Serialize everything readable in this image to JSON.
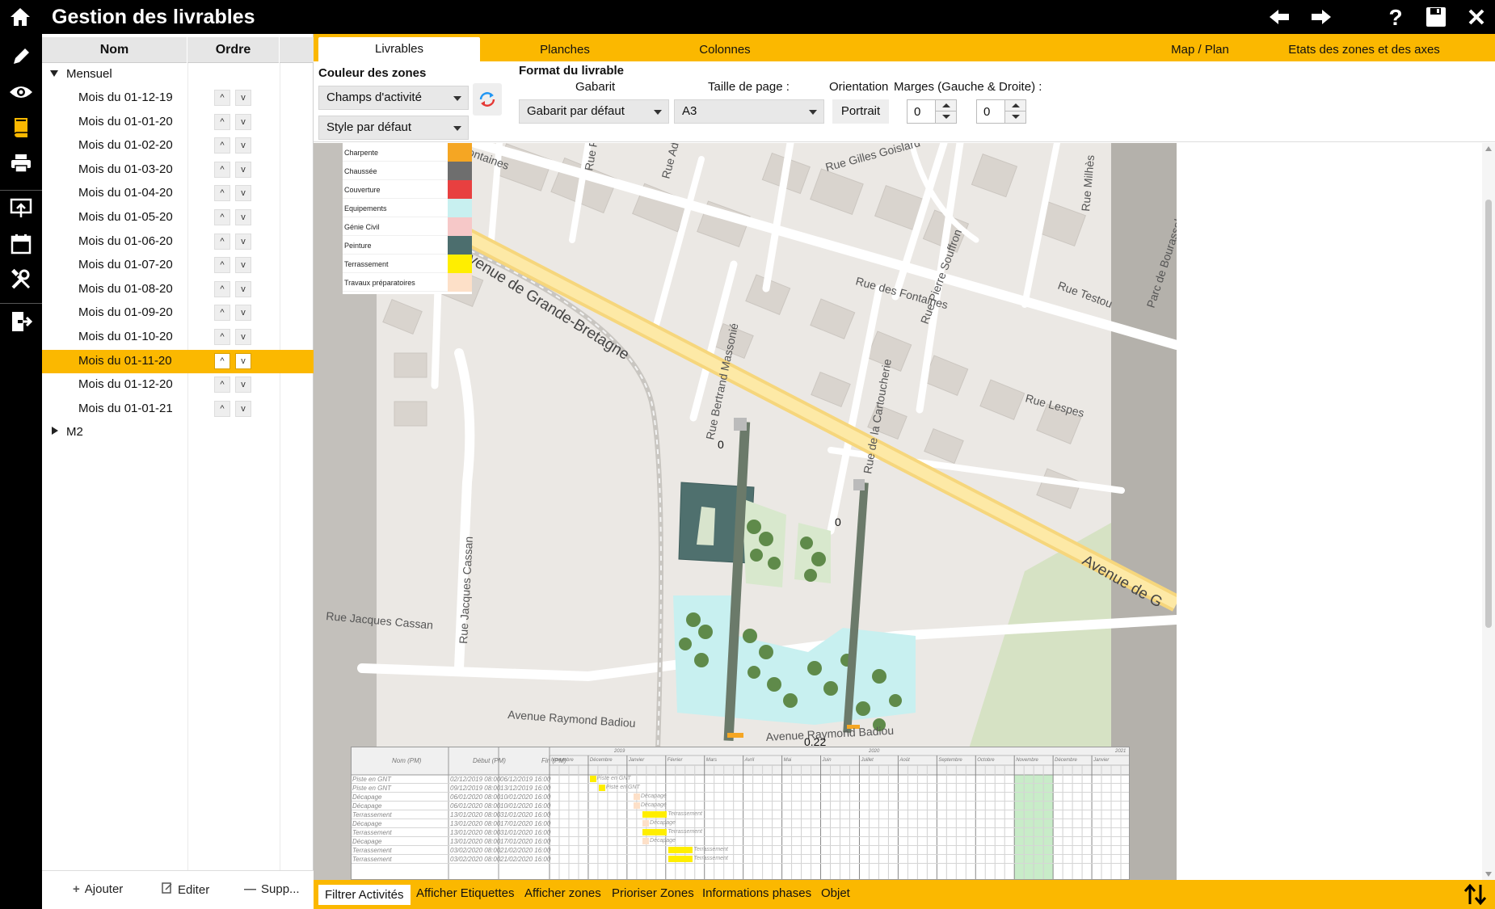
{
  "window": {
    "title": "Gestion des livrables"
  },
  "tree": {
    "header": {
      "name": "Nom",
      "order": "Ordre"
    },
    "groups": [
      {
        "label": "Mensuel",
        "expanded": true,
        "items": [
          {
            "label": "Mois du 01-12-19",
            "up": "^",
            "down": "v"
          },
          {
            "label": "Mois du 01-01-20",
            "up": "^",
            "down": "v"
          },
          {
            "label": "Mois du 01-02-20",
            "up": "^",
            "down": "v"
          },
          {
            "label": "Mois du 01-03-20",
            "up": "^",
            "down": "v"
          },
          {
            "label": "Mois du 01-04-20",
            "up": "^",
            "down": "v"
          },
          {
            "label": "Mois du 01-05-20",
            "up": "^",
            "down": "v"
          },
          {
            "label": "Mois du 01-06-20",
            "up": "^",
            "down": "v"
          },
          {
            "label": "Mois du 01-07-20",
            "up": "^",
            "down": "v"
          },
          {
            "label": "Mois du 01-08-20",
            "up": "^",
            "down": "v"
          },
          {
            "label": "Mois du 01-09-20",
            "up": "^",
            "down": "v"
          },
          {
            "label": "Mois du 01-10-20",
            "up": "^",
            "down": "v"
          },
          {
            "label": "Mois du 01-11-20",
            "up": "^",
            "down": "v",
            "selected": true
          },
          {
            "label": "Mois du 01-12-20",
            "up": "^",
            "down": "v"
          },
          {
            "label": "Mois du 01-01-21",
            "up": "^",
            "down": "v"
          }
        ]
      },
      {
        "label": "M2",
        "expanded": false,
        "items": []
      }
    ],
    "footer": {
      "add": "Ajouter",
      "edit": "Editer",
      "delete": "Supp..."
    }
  },
  "tabs": [
    {
      "label": "Livrables",
      "active": true
    },
    {
      "label": "Planches"
    },
    {
      "label": "Colonnes"
    },
    {
      "label": "Map / Plan"
    },
    {
      "label": "Etats des zones et des axes"
    }
  ],
  "settings": {
    "zone_colors_title": "Couleur des zones",
    "zone_color_mode": "Champs d'activité",
    "style": "Style par défaut",
    "format_title": "Format du livrable",
    "template_label": "Gabarit",
    "template_value": "Gabarit par défaut",
    "page_size_label": "Taille de page :",
    "page_size_value": "A3",
    "orientation_label": "Orientation",
    "orientation_value": "Portrait",
    "margins_label": "Marges (Gauche & Droite) :",
    "margin_left": "0",
    "margin_right": "0"
  },
  "legend": [
    {
      "name": "Charpente",
      "color": "#f5a623"
    },
    {
      "name": "Chaussée",
      "color": "#6e6e6e"
    },
    {
      "name": "Couverture",
      "color": "#e84040"
    },
    {
      "name": "Equipements",
      "color": "#c8f0f0"
    },
    {
      "name": "Génie Civil",
      "color": "#f6c8c8"
    },
    {
      "name": "Peinture",
      "color": "#4c6e6e"
    },
    {
      "name": "Terrassement",
      "color": "#ffee00"
    },
    {
      "name": "Travaux préparatoires",
      "color": "#fde0c8"
    }
  ],
  "map": {
    "streets": [
      "Avenue de Grande-Bretagne",
      "Rue des Fontaines",
      "Rue Gilles Goislard",
      "Rue Testou",
      "Rue Lespes",
      "Rue Jacques Cassan",
      "Rue Jacques Cassan",
      "Avenue Raymond Badiou",
      "Avenue Raymond Badiou",
      "Rue Bertrand Massonié",
      "Rue de la Cartoucherie",
      "Rue Pierre Souffron",
      "Rue Milhès",
      "Parc de Bourassol",
      "Avenue de G",
      "ontaines",
      "Rue P",
      "Rue Ado"
    ],
    "axis_labels": [
      "0",
      "0",
      "0.22"
    ]
  },
  "gantt": {
    "headers": {
      "name": "Nom (PM)",
      "start": "Début (PM)",
      "end": "Fin (PM)"
    },
    "years": [
      "2019",
      "2020",
      "2021"
    ],
    "months": [
      "Novembre",
      "Décembre",
      "Janvier",
      "Février",
      "Mars",
      "Avril",
      "Mai",
      "Juin",
      "Juillet",
      "Août",
      "Septembre",
      "Octobre",
      "Novembre",
      "Décembre",
      "Janvier"
    ],
    "rows": [
      {
        "name": "Piste en GNT",
        "start": "02/12/2019 08:00",
        "end": "06/12/2019 16:00",
        "color": "#ffee00"
      },
      {
        "name": "Piste en GNT",
        "start": "09/12/2019 08:00",
        "end": "13/12/2019 16:00",
        "color": "#ffee00"
      },
      {
        "name": "Décapage",
        "start": "06/01/2020 08:00",
        "end": "10/01/2020 16:00",
        "color": "#fde0c8"
      },
      {
        "name": "Décapage",
        "start": "06/01/2020 08:00",
        "end": "10/01/2020 16:00",
        "color": "#fde0c8"
      },
      {
        "name": "Terrassement",
        "start": "13/01/2020 08:00",
        "end": "31/01/2020 16:00",
        "color": "#ffee00"
      },
      {
        "name": "Décapage",
        "start": "13/01/2020 08:00",
        "end": "17/01/2020 16:00",
        "color": "#fde0c8"
      },
      {
        "name": "Terrassement",
        "start": "13/01/2020 08:00",
        "end": "31/01/2020 16:00",
        "color": "#ffee00"
      },
      {
        "name": "Décapage",
        "start": "13/01/2020 08:00",
        "end": "17/01/2020 16:00",
        "color": "#fde0c8"
      },
      {
        "name": "Terrassement",
        "start": "03/02/2020 08:00",
        "end": "21/02/2020 16:00",
        "color": "#ffee00"
      },
      {
        "name": "Terrassement",
        "start": "03/02/2020 08:00",
        "end": "21/02/2020 16:00",
        "color": "#ffee00"
      }
    ]
  },
  "bottom_tabs": [
    {
      "label": "Filtrer Activités",
      "active": true
    },
    {
      "label": "Afficher Etiquettes"
    },
    {
      "label": "Afficher zones"
    },
    {
      "label": "Prioriser Zones"
    },
    {
      "label": "Informations phases"
    },
    {
      "label": "Objet"
    }
  ],
  "colors": {
    "accent": "#fbb800",
    "titlebar": "#000000"
  }
}
